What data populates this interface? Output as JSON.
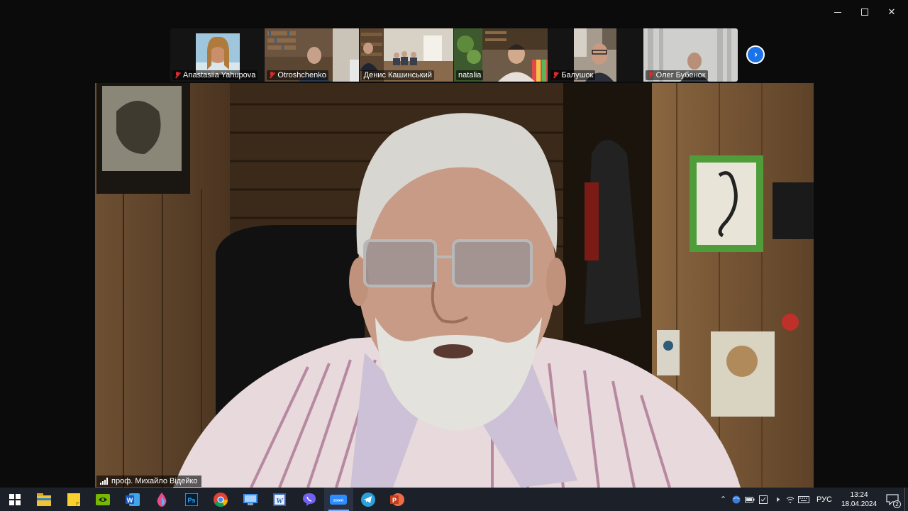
{
  "window": {
    "minimize_icon": "minimize-icon",
    "restore_icon": "restore-icon",
    "close_icon": "close-icon"
  },
  "participants": [
    {
      "name": "Anastasiia Yahupova",
      "muted": true
    },
    {
      "name": "Otroshchenko",
      "muted": true
    },
    {
      "name": "Денис Кашинський",
      "muted": false
    },
    {
      "name": "natalia",
      "muted": false
    },
    {
      "name": "Балушок",
      "muted": true
    },
    {
      "name": "Олег Бубенок",
      "muted": true
    }
  ],
  "next_page_icon": "chevron-right-icon",
  "speaker": {
    "name": "проф. Михайло Відейко"
  },
  "taskbar": {
    "apps": [
      {
        "icon": "windows-start-icon"
      },
      {
        "icon": "file-explorer-icon"
      },
      {
        "icon": "sticky-notes-icon"
      },
      {
        "icon": "nvidia-icon"
      },
      {
        "icon": "word-icon"
      },
      {
        "icon": "color-drop-icon"
      },
      {
        "icon": "photoshop-icon"
      },
      {
        "icon": "chrome-icon"
      },
      {
        "icon": "remote-desktop-icon"
      },
      {
        "icon": "wordpad-icon"
      },
      {
        "icon": "viber-icon"
      },
      {
        "icon": "zoom-icon",
        "label": "zoom",
        "active": true
      },
      {
        "icon": "telegram-icon"
      },
      {
        "icon": "powerpoint-icon"
      }
    ],
    "tray": {
      "language": "РУС",
      "time": "13:24",
      "date": "18.04.2024",
      "notification_count": "2"
    }
  },
  "colors": {
    "accent_blue": "#1a73e8",
    "muted_red": "#e02828",
    "taskbar": "#1c2129"
  }
}
